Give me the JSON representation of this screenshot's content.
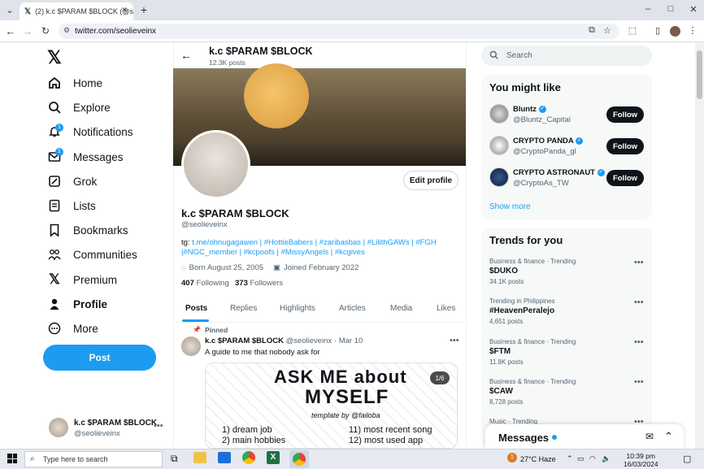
{
  "browser": {
    "tab_title": "(2) k.c $PARAM $BLOCK (@seolieveinx) / X",
    "url": "twitter.com/seolieveinx",
    "new_tab": "+",
    "window_controls": [
      "–",
      "□",
      "✕"
    ]
  },
  "sidebar": {
    "items": [
      {
        "label": "Home",
        "icon": "home-icon"
      },
      {
        "label": "Explore",
        "icon": "search-icon"
      },
      {
        "label": "Notifications",
        "icon": "bell-icon",
        "badge": "1"
      },
      {
        "label": "Messages",
        "icon": "envelope-icon",
        "badge": "1"
      },
      {
        "label": "Grok",
        "icon": "grok-icon"
      },
      {
        "label": "Lists",
        "icon": "list-icon"
      },
      {
        "label": "Bookmarks",
        "icon": "bookmark-icon"
      },
      {
        "label": "Communities",
        "icon": "people-icon"
      },
      {
        "label": "Premium",
        "icon": "x-logo-icon"
      },
      {
        "label": "Profile",
        "icon": "person-icon"
      },
      {
        "label": "More",
        "icon": "more-circle-icon"
      }
    ],
    "post_label": "Post",
    "account": {
      "name": "k.c $PARAM $BLOCK",
      "handle": "@seolieveinx"
    }
  },
  "header": {
    "name": "k.c $PARAM $BLOCK",
    "posts": "12.3K posts"
  },
  "profile": {
    "edit_label": "Edit profile",
    "name": "k.c $PARAM $BLOCK",
    "handle": "@seolieveinx",
    "bio_prefix": "tg: ",
    "bio_line1": "t.me/ohnugagawen | #HottieBabers | #zaribasbas | #LilithGAWs | #FGH",
    "bio_line2": "|#NGC_member | #kcpoofs | #MissyAngels | #kcgives",
    "born": "Born August 25, 2005",
    "joined": "Joined February 2022",
    "following_count": "407",
    "following_label": "Following",
    "followers_count": "373",
    "followers_label": "Followers"
  },
  "tabs": [
    "Posts",
    "Replies",
    "Highlights",
    "Articles",
    "Media",
    "Likes"
  ],
  "pinned": {
    "label": "Pinned",
    "name": "k.c $PARAM $BLOCK",
    "handle": "@seolieveinx",
    "sep": "·",
    "date": "Mar 10",
    "text": "A guide to me that nobody ask for",
    "media_counter": "1/6",
    "image_title_1": "ASK ME about",
    "image_title_2": "MYSELF",
    "image_sub": "template by @failoba",
    "image_list_left": [
      "1) dream job",
      "2) main hobbies"
    ],
    "image_list_right": [
      "11) most recent song",
      "12) most used app"
    ]
  },
  "right": {
    "search_placeholder": "Search",
    "might_like_title": "You might like",
    "suggestions": [
      {
        "name": "Bluntz",
        "handle": "@Bluntz_Capital",
        "follow": "Follow"
      },
      {
        "name": "CRYPTO PANDA",
        "handle": "@CryptoPanda_gl",
        "follow": "Follow"
      },
      {
        "name": "CRYPTO ASTRONAUT",
        "handle": "@CryptoAs_TW",
        "follow": "Follow"
      }
    ],
    "show_more": "Show more",
    "trends_title": "Trends for you",
    "trends": [
      {
        "meta": "Business & finance · Trending",
        "name": "$DUKO",
        "count": "34.1K posts"
      },
      {
        "meta": "Trending in Philippines",
        "name": "#HeavenPeralejo",
        "count": "4,651 posts"
      },
      {
        "meta": "Business & finance · Trending",
        "name": "$FTM",
        "count": "11.8K posts"
      },
      {
        "meta": "Business & finance · Trending",
        "name": "$CAW",
        "count": "8,728 posts"
      },
      {
        "meta": "Music · Trending",
        "name": "",
        "count": ""
      }
    ],
    "messages_label": "Messages"
  },
  "taskbar": {
    "search_placeholder": "Type here to search",
    "weather": "27°C Haze",
    "time": "10:39 pm",
    "date": "16/03/2024",
    "notif_count": "1"
  },
  "colors": {
    "accent": "#1d9bf0",
    "text": "#0f1419",
    "muted": "#536471"
  }
}
